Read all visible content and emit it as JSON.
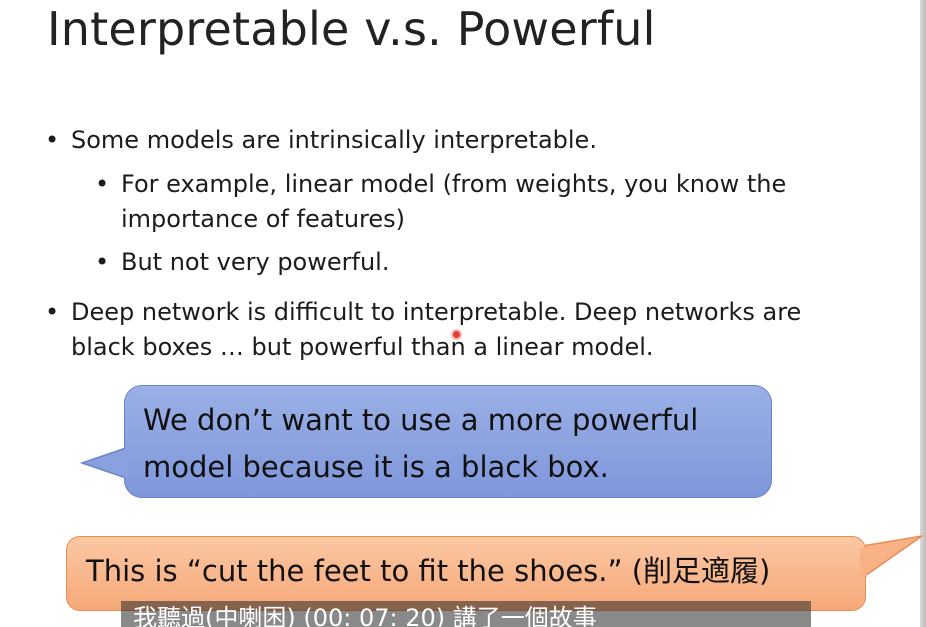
{
  "slide": {
    "title": "Interpretable v.s. Powerful",
    "bullets": [
      {
        "text": "Some models are intrinsically interpretable.",
        "level": 1
      },
      {
        "text": "For example, linear model (from weights, you know the importance of features)",
        "level": 2
      },
      {
        "text": "But not very powerful.",
        "level": 2
      },
      {
        "text": "Deep network is difficult to interpretable. Deep networks are black boxes … but powerful than a linear model.",
        "level": 1
      }
    ],
    "bullet_symbol": "•",
    "callout_blue": {
      "text": "We don’t want to use a more powerful model because it is a black box.",
      "fill": "#8fa6e2"
    },
    "callout_orange": {
      "text": "This is “cut the feet to fit the shoes.” (削足適履)",
      "fill": "#f9b98d"
    },
    "subtitle": "我聽過(中喇困) (00: 07: 20) 講了一個故事"
  },
  "cursor": {
    "color": "#e43b3b"
  }
}
